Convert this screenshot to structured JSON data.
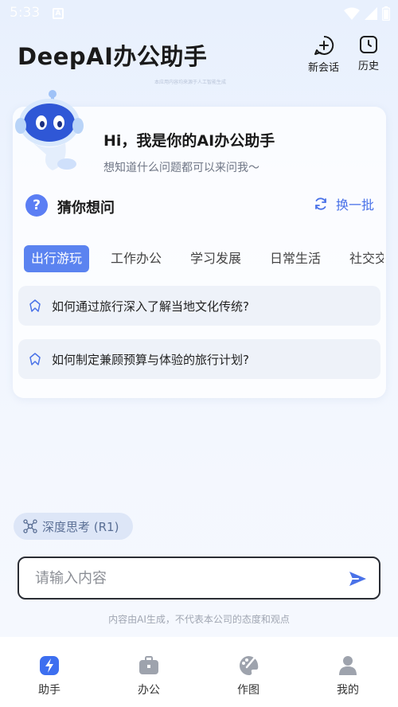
{
  "status": {
    "time": "5:33",
    "badge": "A"
  },
  "header": {
    "title": "DeepAI办公助手",
    "subtitle": "本应用内容均来源于人工智能生成",
    "new_chat_label": "新会话",
    "history_label": "历史"
  },
  "greeting": {
    "title": "Hi，我是你的AI办公助手",
    "subtitle": "想知道什么问题都可以来问我～"
  },
  "guess": {
    "icon_text": "?",
    "title": "猜你想问",
    "refresh_label": "换一批"
  },
  "tabs": [
    {
      "label": "出行游玩",
      "active": true
    },
    {
      "label": "工作办公"
    },
    {
      "label": "学习发展"
    },
    {
      "label": "日常生活"
    },
    {
      "label": "社交交"
    }
  ],
  "questions": [
    {
      "text": "如何通过旅行深入了解当地文化传统?"
    },
    {
      "text": "如何制定兼顾预算与体验的旅行计划?"
    }
  ],
  "deep_think": {
    "label": "深度思考 (R1)"
  },
  "input": {
    "placeholder": "请输入内容"
  },
  "disclaimer": "内容由AI生成，不代表本公司的态度和观点",
  "nav": [
    {
      "label": "助手",
      "icon": "lightning-icon",
      "active": true
    },
    {
      "label": "办公",
      "icon": "briefcase-icon"
    },
    {
      "label": "作图",
      "icon": "palette-icon"
    },
    {
      "label": "我的",
      "icon": "person-icon"
    }
  ],
  "colors": {
    "accent": "#5b83f0",
    "text": "#1a1a1a",
    "muted": "#6f7685",
    "nav_icon": "#9ea3ad",
    "nav_active": "#3d6ff0"
  }
}
